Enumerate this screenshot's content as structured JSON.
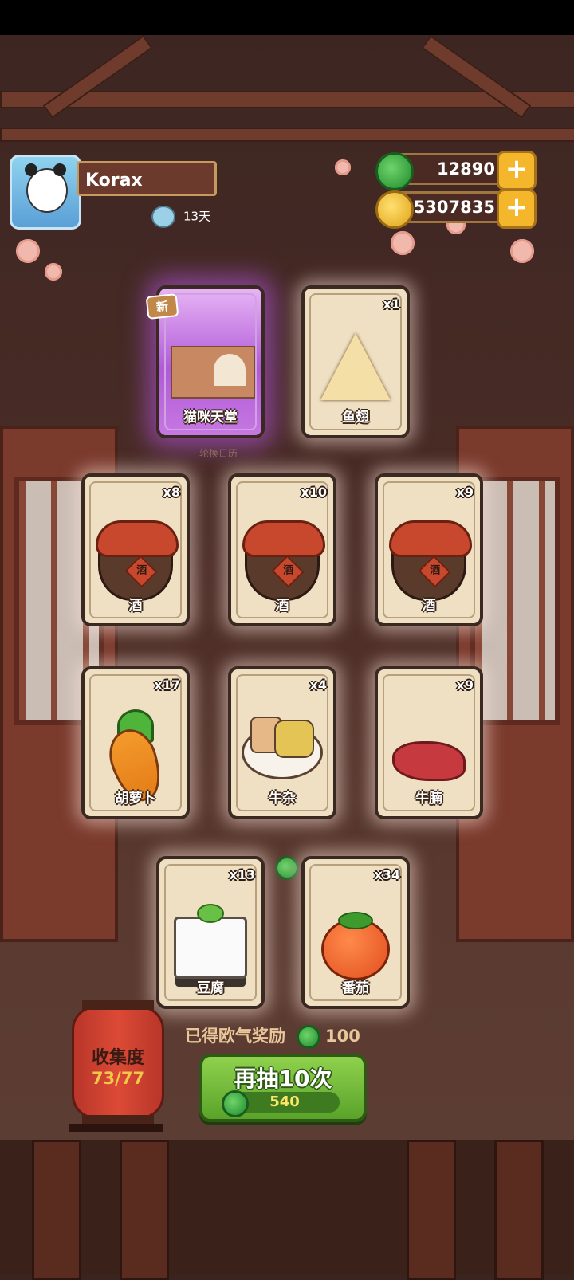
{
  "profile": {
    "name": "Korax",
    "days": "13天"
  },
  "currency": {
    "jade": "12890",
    "coins": "5307835"
  },
  "top_cards": [
    {
      "label": "猫咪天堂",
      "badge": "新",
      "qty": ""
    },
    {
      "label": "鱼翅",
      "qty": "x1"
    }
  ],
  "calendar_label": "轮换日历",
  "cards": [
    {
      "label": "酒",
      "qty": "x8"
    },
    {
      "label": "酒",
      "qty": "x10"
    },
    {
      "label": "酒",
      "qty": "x9"
    },
    {
      "label": "胡萝卜",
      "qty": "x17"
    },
    {
      "label": "牛杂",
      "qty": "x4"
    },
    {
      "label": "牛腩",
      "qty": "x9"
    },
    {
      "label": "豆腐",
      "qty": "x13"
    },
    {
      "label": "番茄",
      "qty": "x34"
    }
  ],
  "jar_mark": "酒",
  "collection": {
    "title": "收集度",
    "progress": "73/77"
  },
  "reward": {
    "text": "已得欧气奖励",
    "amount": "100"
  },
  "redraw": {
    "label": "再抽10次",
    "cost": "540"
  },
  "colors": {
    "jade": "#1f8a2c",
    "coin": "#e0a219",
    "button_green": "#5aa32a",
    "lantern_red": "#dc4a35"
  }
}
